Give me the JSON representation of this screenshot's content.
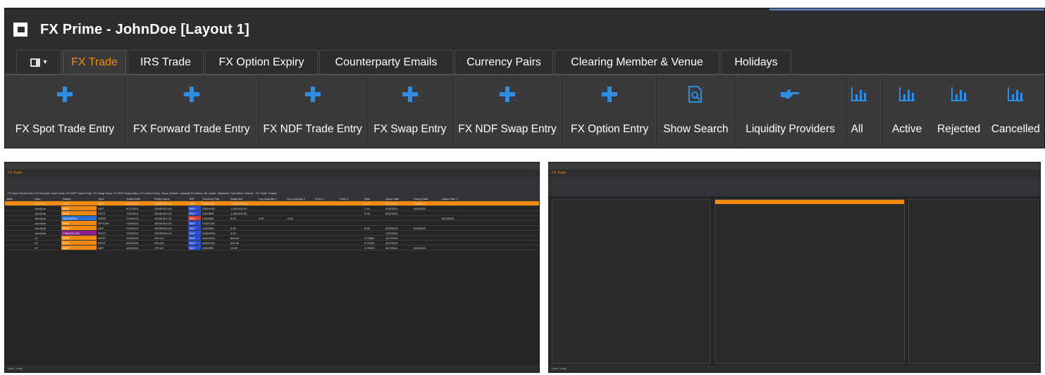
{
  "window": {
    "title": "FX Prime - JohnDoe [Layout 1]"
  },
  "tabs": [
    {
      "label": "FX Trade",
      "active": true
    },
    {
      "label": "IRS Trade"
    },
    {
      "label": "FX Option Expiry"
    },
    {
      "label": "Counterparty Emails"
    },
    {
      "label": "Currency Pairs"
    },
    {
      "label": "Clearing Member & Venue"
    },
    {
      "label": "Holidays"
    }
  ],
  "ribbon": {
    "buttons": [
      {
        "label": "FX Spot Trade Entry",
        "icon": "plus-icon"
      },
      {
        "label": "FX Forward Trade Entry",
        "icon": "plus-icon"
      },
      {
        "label": "FX NDF Trade Entry",
        "icon": "plus-icon"
      },
      {
        "label": "FX Swap Entry",
        "icon": "plus-icon"
      },
      {
        "label": "FX NDF Swap Entry",
        "icon": "plus-icon"
      },
      {
        "label": "FX Option Entry",
        "icon": "plus-icon"
      },
      {
        "label": "Show Search",
        "icon": "search-document-icon"
      },
      {
        "label": "Liquidity Providers",
        "icon": "pointing-hand-icon"
      },
      {
        "label": "All",
        "icon": "chart-icon"
      },
      {
        "label": "Active",
        "icon": "chart-icon"
      },
      {
        "label": "Rejected",
        "icon": "chart-icon"
      },
      {
        "label": "Cancelled",
        "icon": "chart-icon"
      }
    ]
  },
  "colors": {
    "accent": "#f28a12",
    "icon_blue": "#2d8ee3",
    "background": "#2d2d30"
  },
  "preview_left": {
    "title": "FX Trade",
    "ribbon_labels": [
      "FX Spot Trade Entry",
      "FX Forward Trade Entry",
      "FX NDF Trade Entry",
      "FX Swap Entry",
      "FX NDF Swap Entry",
      "FX Option Entry",
      "Show Search",
      "Liquidity Providers",
      "All",
      "Active",
      "Rejected",
      "Cancelled",
      "Cancel - FX Trade",
      "Export"
    ],
    "columns": [
      "Alias",
      "User",
      "Status",
      "Type",
      "Trade Date",
      "Entity Name",
      "B/S",
      "Currency Pair",
      "Dealt Amt",
      "Leg Quantity 1",
      "Leg Quantity 2",
      "Price 1",
      "Price 2",
      "Rate",
      "Value Date",
      "Fixing Date",
      "Value Date 1"
    ],
    "rows": [
      [
        "",
        "JohnDoe",
        "NEW",
        "NDF",
        "8/27/2021",
        "GENESIS-US",
        "SELL",
        "GBP/USD",
        "-1,000,000.00",
        "",
        "",
        "",
        "",
        "1.41",
        "8/31/2021",
        "8/26/2021",
        ""
      ],
      [
        "",
        "JohnDoe",
        "NEW",
        "NDF",
        "8/27/2021",
        "GENESIS-US",
        "BUY",
        "GBP/USD",
        "1,000,000.00",
        "",
        "",
        "",
        "",
        "1.41",
        "9/30/2021",
        "9/26/2021",
        ""
      ],
      [
        "",
        "JohnDoe",
        "NEW",
        "SPOT",
        "7/29/2021",
        "GENESIS-US",
        "BUY",
        "USD/BRL",
        "1,000,000.00",
        "",
        "",
        "",
        "",
        "5.00",
        "8/31/2021",
        "",
        ""
      ],
      [
        "",
        "JohnDoe",
        "AMENDED",
        "SWAP",
        "7/29/2021",
        "GENESIS-US",
        "SELL",
        "USD/BRL",
        "5.00",
        "5.00",
        "-5.00",
        "",
        "",
        "",
        "",
        "",
        "8/23/2021"
      ],
      [
        "",
        "JohnDoe",
        "NEW",
        "OPTION",
        "7/29/2021",
        "GENESIS-US",
        "BUY",
        "USD/CAD",
        "",
        "",
        "",
        "",
        "",
        "",
        "",
        "",
        ""
      ],
      [
        "",
        "JohnDoe",
        "NEW",
        "NDF",
        "7/29/2021",
        "GENESIS-US",
        "BUY",
        "USD/BRL",
        "4.00",
        "",
        "",
        "",
        "",
        "5.00",
        "8/23/2021",
        "8/19/2021",
        ""
      ],
      [
        "",
        "JohnDoe",
        "CANCELLED",
        "SPOT",
        "7/29/2021",
        "GENESIS-US",
        "BUY",
        "USD/MXD",
        "5.00",
        "",
        "",
        "",
        "",
        "",
        "7/22/2021",
        "",
        ""
      ],
      [
        "",
        "LP",
        "NEW",
        "SPOT",
        "4/23/2021",
        "XPLUS",
        "BUY",
        "AUD/USD",
        "600.00",
        "",
        "",
        "",
        "",
        "0.70662",
        "4/27/2021",
        "",
        ""
      ],
      [
        "",
        "LP",
        "NEW",
        "SPOT",
        "4/23/2021",
        "XPLUS",
        "BUY",
        "AUD/USD",
        "600.00",
        "",
        "",
        "",
        "",
        "0.70624",
        "4/27/2021",
        "",
        ""
      ],
      [
        "",
        "LP",
        "NEW",
        "NDF",
        "4/23/2021",
        "XPLUS",
        "BUY",
        "USD/BRL",
        "10.00",
        "",
        "",
        "",
        "",
        "3.79633",
        "5/27/2021",
        "5/25/2021",
        ""
      ]
    ]
  },
  "preview_right": {
    "title": "FX Trade",
    "footer": "Date: Today"
  }
}
